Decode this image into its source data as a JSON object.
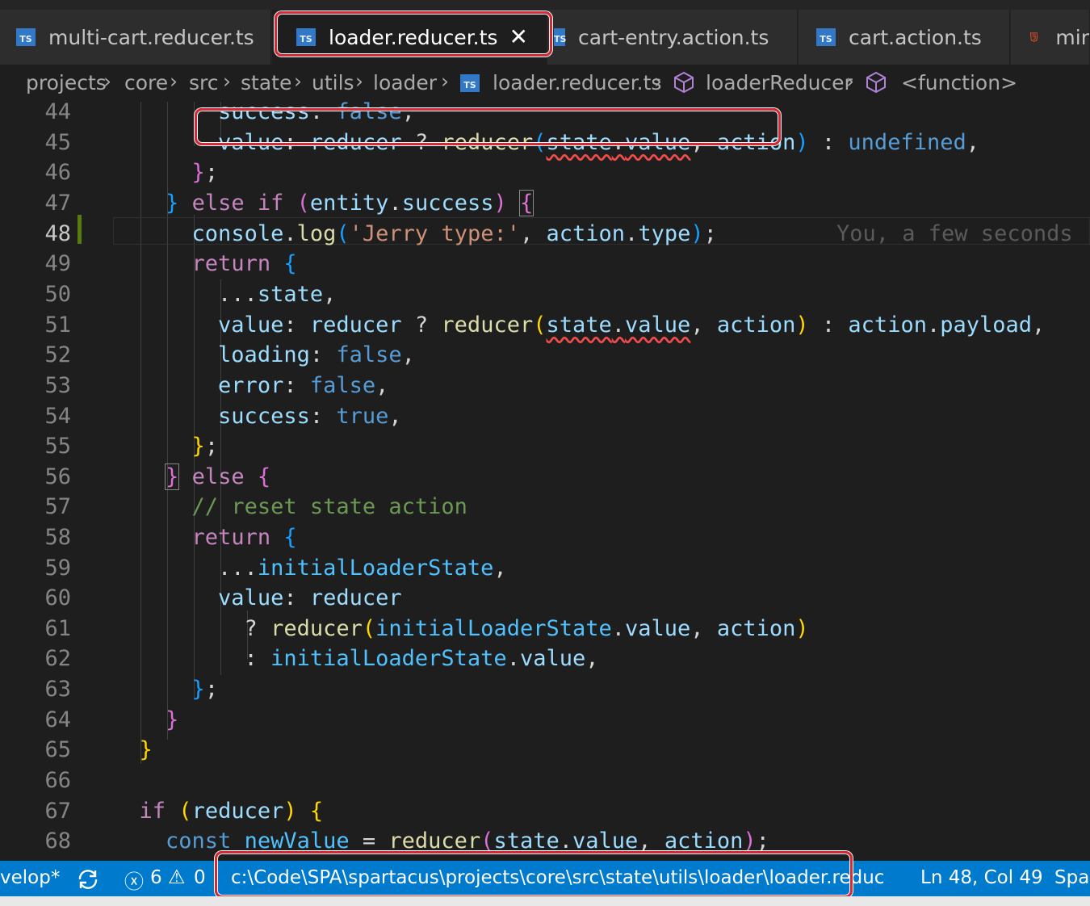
{
  "tabs": [
    {
      "label": "multi-cart.reducer.ts",
      "icon": "typescript-file-icon",
      "active": false
    },
    {
      "label": "loader.reducer.ts",
      "icon": "typescript-file-icon",
      "active": true
    },
    {
      "label": "cart-entry.action.ts",
      "icon": "typescript-file-icon",
      "active": false
    },
    {
      "label": "cart.action.ts",
      "icon": "typescript-file-icon",
      "active": false
    },
    {
      "label": "mir",
      "icon": "html-file-icon",
      "active": false
    }
  ],
  "breadcrumb": [
    "projects",
    "core",
    "src",
    "state",
    "utils",
    "loader",
    "loader.reducer.ts",
    "loaderReducer",
    "<function>"
  ],
  "line_numbers": [
    "44",
    "45",
    "46",
    "47",
    "48",
    "49",
    "50",
    "51",
    "52",
    "53",
    "54",
    "55",
    "56",
    "57",
    "58",
    "59",
    "60",
    "61",
    "62",
    "63",
    "64",
    "65",
    "66",
    "67",
    "68"
  ],
  "blame_annotation": "You, a few seconds",
  "status_bar": {
    "branch": "velop*",
    "errors": "6",
    "warnings": "0",
    "file_path": "c:\\Code\\SPA\\spartacus\\projects\\core\\src\\state\\utils\\loader\\loader.reduc",
    "cursor": "Ln 48, Col 49",
    "spaces": "Spac"
  },
  "colors": {
    "accent": "#007acc",
    "highlight_box": "#d42a35",
    "editor_bg": "#1e1e1e"
  }
}
